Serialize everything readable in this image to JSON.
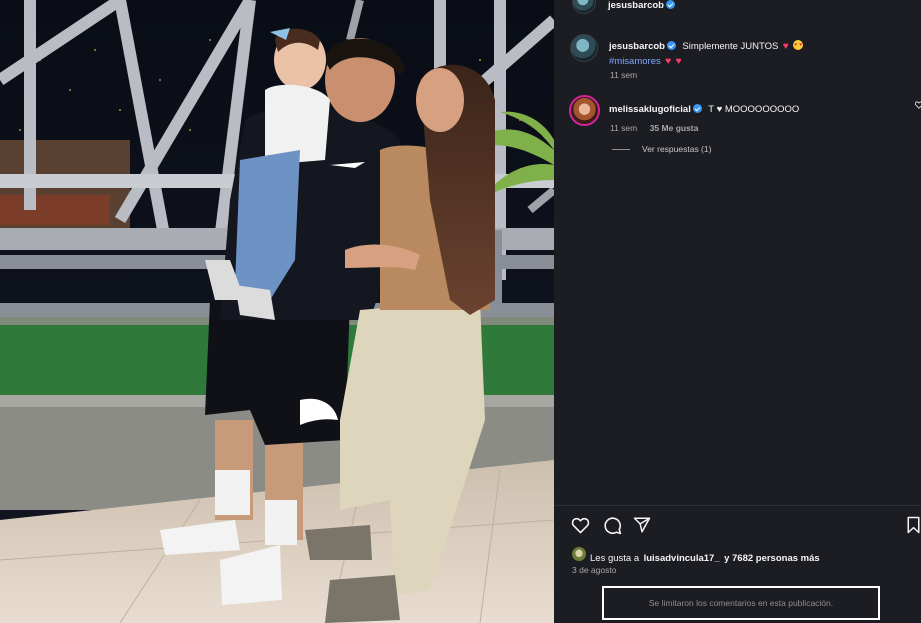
{
  "post": {
    "header_username": "jesusbarcob",
    "caption": {
      "username": "jesusbarcob",
      "text": "Simplemente JUNTOS",
      "hashtag": "#misamores",
      "time": "11 sem"
    },
    "comments": [
      {
        "username": "melissaklugoficial",
        "text": "T ♥ MOOOOOOOOO",
        "time": "11 sem",
        "likes": "35 Me gusta",
        "replies": "Ver respuestas (1)"
      }
    ],
    "likes": {
      "prefix": "Les gusta a",
      "user": "luisadvincula17_",
      "suffix": "y 7682 personas más"
    },
    "date": "3 de agosto",
    "comments_limited": "Se limitaron los comentarios en esta publicación."
  },
  "icons": {
    "like": "heart-outline-icon",
    "comment": "comment-bubble-icon",
    "share": "send-paper-plane-icon",
    "save": "bookmark-icon",
    "comment_like": "small-heart-icon"
  },
  "colors": {
    "panel_bg": "#1c1d22",
    "link_blue": "#7fa8ff",
    "verified_blue": "#3897f0",
    "heart_red": "#ff3b6b",
    "muted_text": "#a8a8a8",
    "story_ring": "#d6249f"
  }
}
